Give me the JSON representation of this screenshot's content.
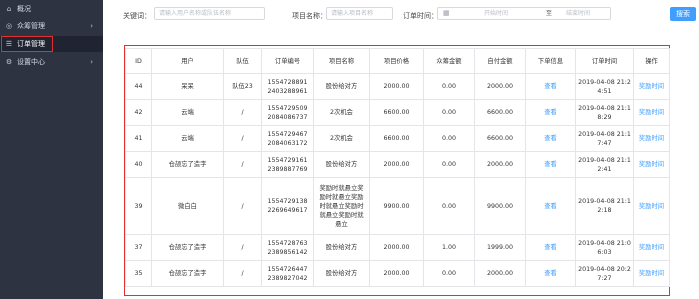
{
  "sidebar": {
    "items": [
      {
        "label": "概况",
        "icon": "home-icon",
        "has_submenu": false
      },
      {
        "label": "众筹管理",
        "icon": "funding-icon",
        "has_submenu": true
      },
      {
        "label": "订单管理",
        "icon": "list-icon",
        "has_submenu": false,
        "active": true
      },
      {
        "label": "设置中心",
        "icon": "gear-icon",
        "has_submenu": true
      }
    ],
    "chevron": "›"
  },
  "search": {
    "keyword_label": "关键词：",
    "keyword_placeholder": "请输入用户名称或队伍名称",
    "project_label": "项目名称：",
    "project_placeholder": "请输入项目名称",
    "order_time_label": "订单时间：",
    "start_placeholder": "开始时间",
    "range_separator": "至",
    "end_placeholder": "结束时间",
    "search_button": "搜索"
  },
  "table": {
    "columns": [
      "ID",
      "用户",
      "队伍",
      "订单编号",
      "项目名称",
      "项目价格",
      "众筹金额",
      "自付金额",
      "下单信息",
      "订单时间",
      "操作"
    ],
    "rows": [
      {
        "id": "44",
        "user": "呆呆",
        "team": "队伍23",
        "order_no": "1554728891\n2403288961",
        "project": "股份给对方",
        "price": "2000.00",
        "crowd": "0.00",
        "self": "2000.00",
        "info": "查看",
        "time": "2019-04-08 21:2\n4:51",
        "action": "奖励时间"
      },
      {
        "id": "42",
        "user": "云端",
        "team": "/",
        "order_no": "1554729509\n2084086737",
        "project": "2次机会",
        "price": "6600.00",
        "crowd": "0.00",
        "self": "6600.00",
        "info": "查看",
        "time": "2019-04-08 21:1\n8:29",
        "action": "奖励时间"
      },
      {
        "id": "41",
        "user": "云端",
        "team": "/",
        "order_no": "1554729467\n2084063172",
        "project": "2次机会",
        "price": "6600.00",
        "crowd": "0.00",
        "self": "6600.00",
        "info": "查看",
        "time": "2019-04-08 21:1\n7:47",
        "action": "奖励时间"
      },
      {
        "id": "40",
        "user": "仓颉忘了造字",
        "team": "/",
        "order_no": "1554729161\n2389887769",
        "project": "股份给对方",
        "price": "2000.00",
        "crowd": "0.00",
        "self": "2000.00",
        "info": "查看",
        "time": "2019-04-08 21:1\n2:41",
        "action": "奖励时间"
      },
      {
        "id": "39",
        "user": "微白白",
        "team": "/",
        "order_no": "1554729138\n2269649617",
        "project": "奖励时就悬立奖\n励时就悬立奖励\n时就悬立奖励时\n就悬立奖励时就\n悬立",
        "price": "9900.00",
        "crowd": "0.00",
        "self": "9900.00",
        "info": "查看",
        "time": "2019-04-08 21:1\n2:18",
        "action": "奖励时间",
        "tall": true
      },
      {
        "id": "37",
        "user": "仓颉忘了造字",
        "team": "/",
        "order_no": "1554728763\n2389856142",
        "project": "股份给对方",
        "price": "2000.00",
        "crowd": "1.00",
        "self": "1999.00",
        "info": "查看",
        "time": "2019-04-08 21:0\n6:03",
        "action": "奖励时间"
      },
      {
        "id": "35",
        "user": "仓颉忘了造字",
        "team": "/",
        "order_no": "1554726447\n2389827042",
        "project": "股份给对方",
        "price": "2000.00",
        "crowd": "0.00",
        "self": "2000.00",
        "info": "查看",
        "time": "2019-04-08 20:2\n7:27",
        "action": "奖励时间"
      }
    ]
  },
  "colors": {
    "sidebar_bg": "#2d3341",
    "accent": "#409eff",
    "highlight": "#e03131"
  }
}
